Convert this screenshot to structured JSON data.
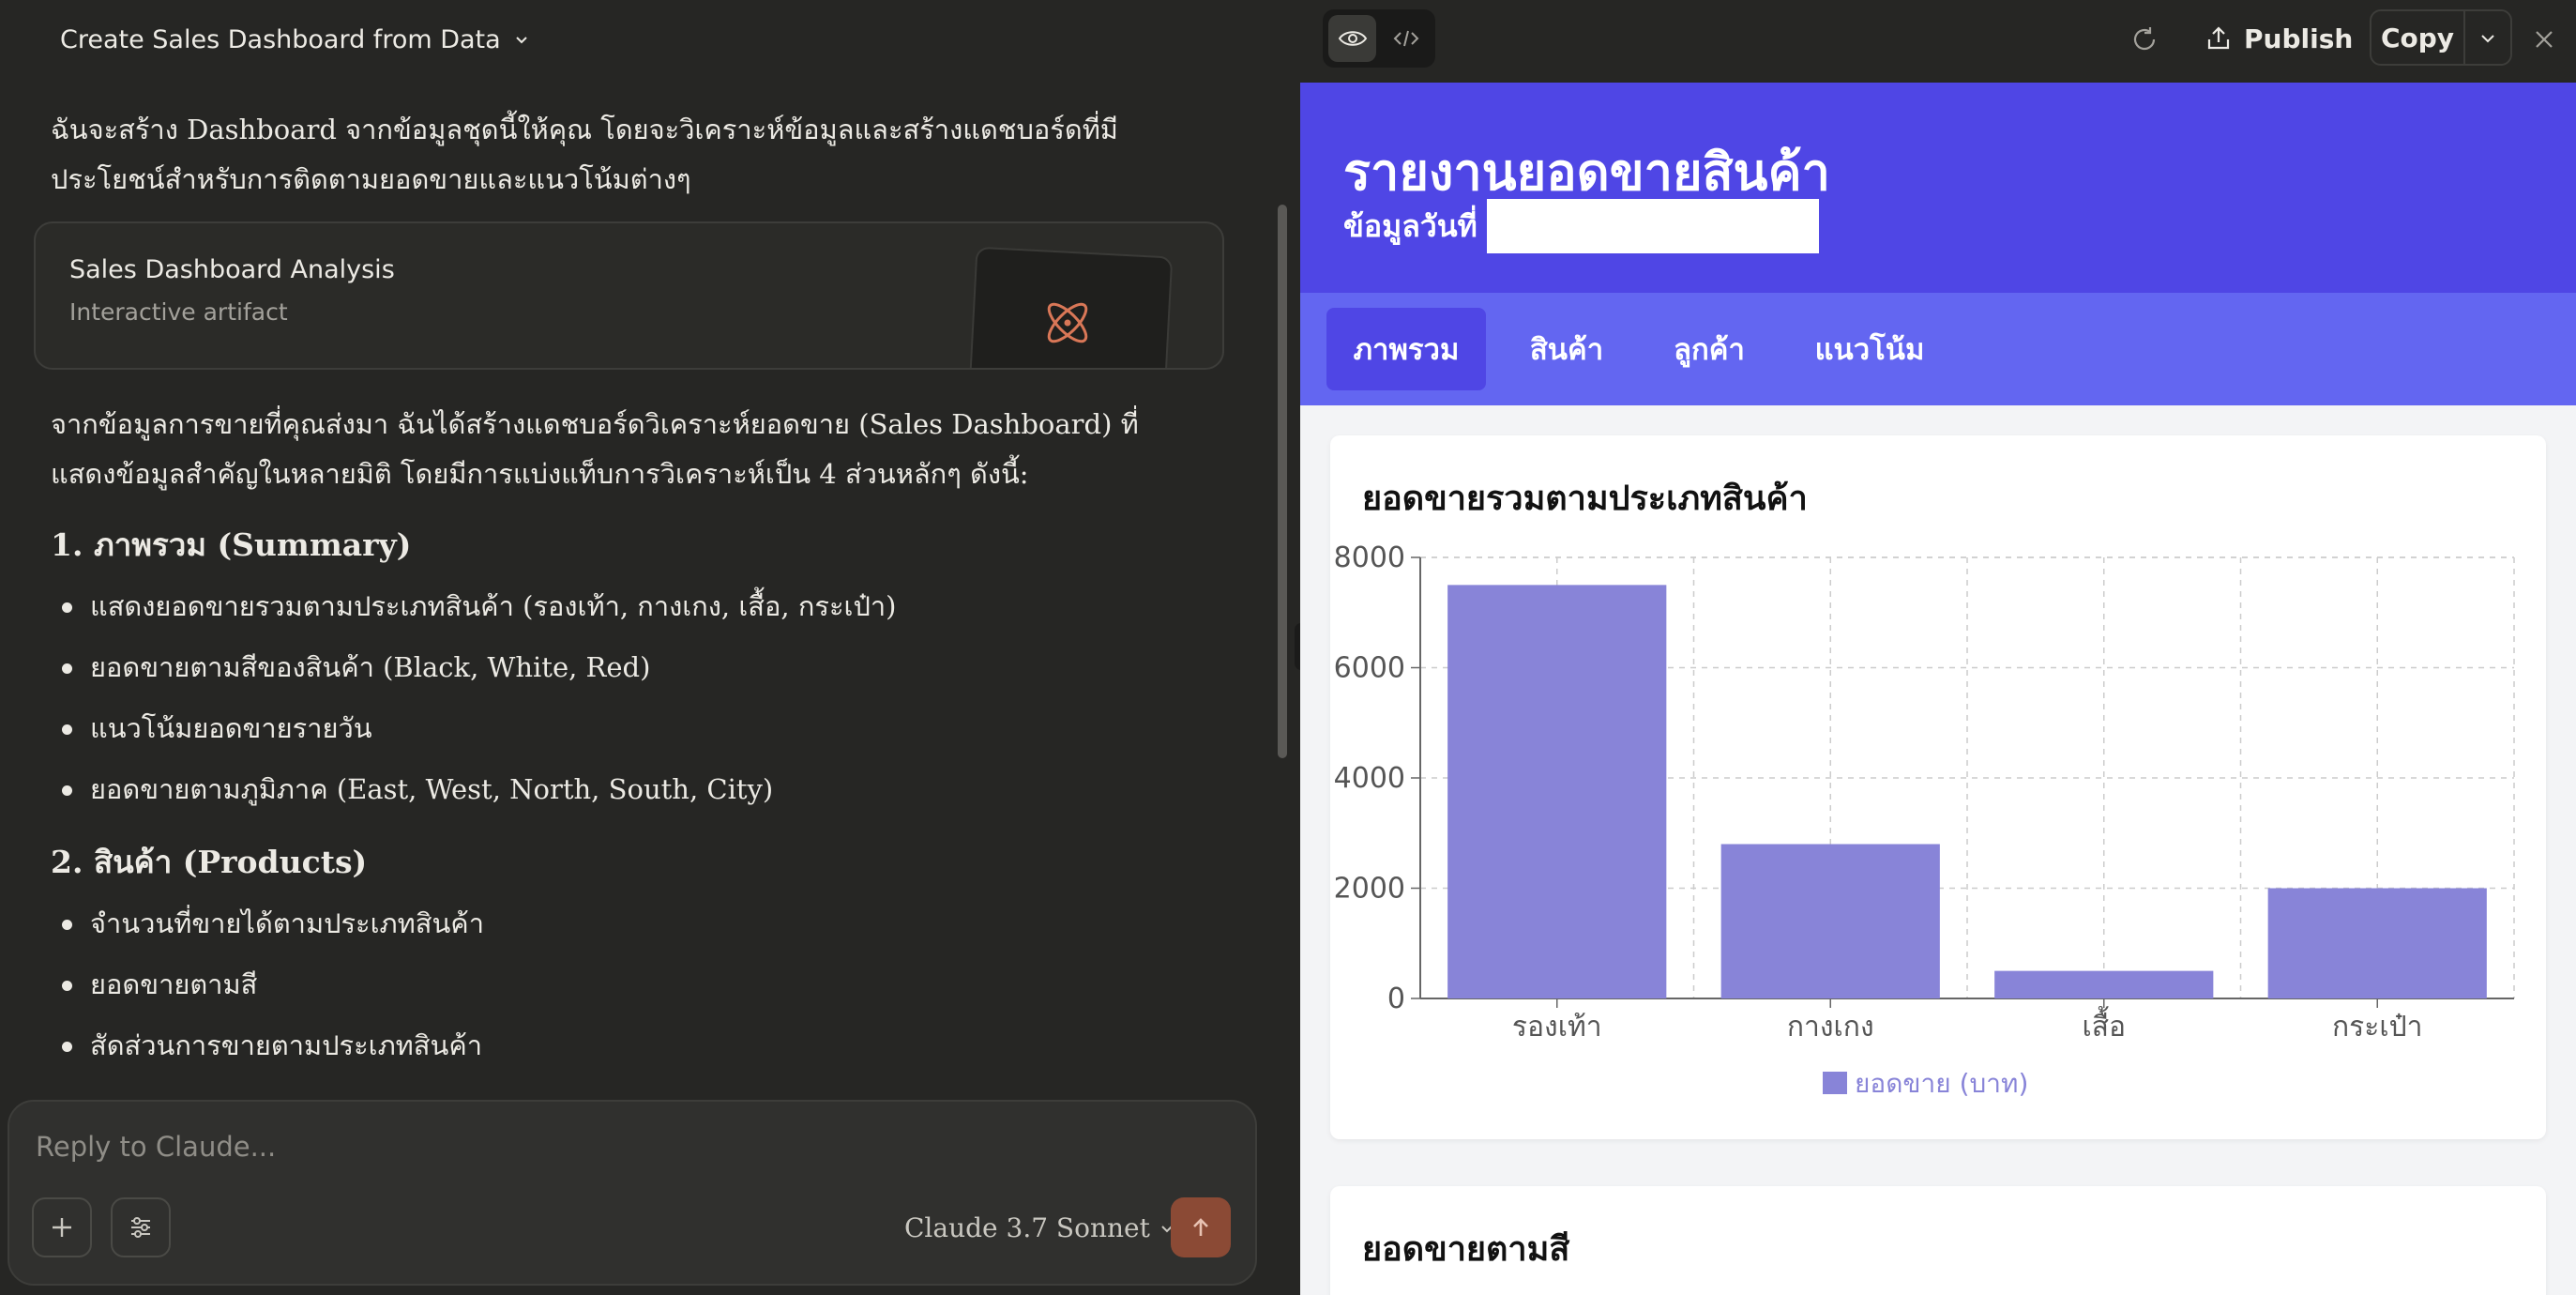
{
  "conversation": {
    "title": "Create Sales Dashboard from Data"
  },
  "chat": {
    "intro": "ฉันจะสร้าง Dashboard จากข้อมูลชุดนี้ให้คุณ โดยจะวิเคราะห์ข้อมูลและสร้างแดชบอร์ดที่มีประโยชน์สำหรับการติดตามยอดขายและแนวโน้มต่างๆ",
    "artifact": {
      "title": "Sales Dashboard Analysis",
      "subtitle": "Interactive artifact",
      "icon": "atom-icon"
    },
    "summary": "จากข้อมูลการขายที่คุณส่งมา ฉันได้สร้างแดชบอร์ดวิเคราะห์ยอดขาย (Sales Dashboard) ที่แสดงข้อมูลสำคัญในหลายมิติ โดยมีการแบ่งแท็บการวิเคราะห์เป็น 4 ส่วนหลักๆ ดังนี้:",
    "sections": [
      {
        "heading": "1. ภาพรวม (Summary)",
        "bullets": [
          "แสดงยอดขายรวมตามประเภทสินค้า (รองเท้า, กางเกง, เสื้อ, กระเป๋า)",
          "ยอดขายตามสีของสินค้า (Black, White, Red)",
          "แนวโน้มยอดขายรายวัน",
          "ยอดขายตามภูมิภาค (East, West, North, South, City)"
        ]
      },
      {
        "heading": "2. สินค้า (Products)",
        "bullets": [
          "จำนวนที่ขายได้ตามประเภทสินค้า",
          "ยอดขายตามสี",
          "สัดส่วนการขายตามประเภทสินค้า"
        ]
      }
    ]
  },
  "composer": {
    "placeholder": "Reply to Claude...",
    "model": "Claude 3.7 Sonnet"
  },
  "toolbar": {
    "publish_label": "Publish",
    "copy_label": "Copy"
  },
  "report": {
    "title": "รายงานยอดขายสินค้า",
    "date_label": "ข้อมูลวันที่",
    "tabs": [
      "ภาพรวม",
      "สินค้า",
      "ลูกค้า",
      "แนวโน้ม"
    ],
    "active_tab": "ภาพรวม",
    "chart_card_title": "ยอดขายรวมตามประเภทสินค้า",
    "second_card_title": "ยอดขายตามสี"
  },
  "colors": {
    "header": "#4f46e5",
    "tabs_bar": "#6366f1",
    "bar": "#8884d8",
    "send_button": "#8b4a35"
  },
  "chart_data": {
    "type": "bar",
    "title": "ยอดขายรวมตามประเภทสินค้า",
    "categories": [
      "รองเท้า",
      "กางเกง",
      "เสื้อ",
      "กระเป๋า"
    ],
    "series": [
      {
        "name": "ยอดขาย (บาท)",
        "values": [
          7500,
          2800,
          500,
          2000
        ]
      }
    ],
    "ylim": [
      0,
      8000
    ],
    "yticks": [
      0,
      2000,
      4000,
      6000,
      8000
    ],
    "grid": true,
    "legend": "bottom"
  }
}
